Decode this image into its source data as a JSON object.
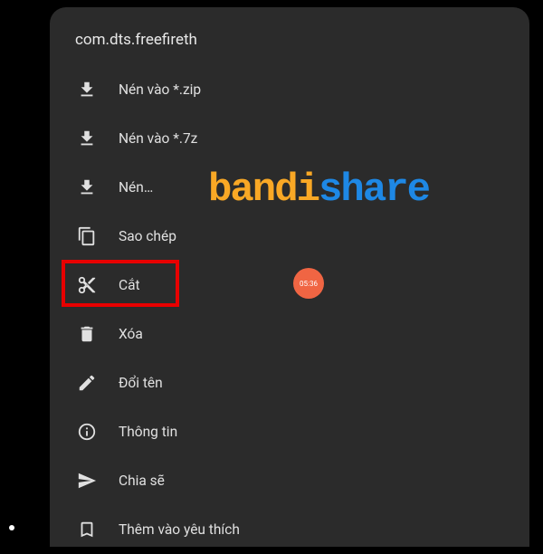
{
  "title": "com.dts.freefireth",
  "menu": [
    {
      "label": "Nén vào *.zip",
      "icon": "download-icon"
    },
    {
      "label": "Nén vào *.7z",
      "icon": "download-icon"
    },
    {
      "label": "Nén…",
      "icon": "download-icon"
    },
    {
      "label": "Sao chép",
      "icon": "copy-icon"
    },
    {
      "label": "Cắt",
      "icon": "cut-icon"
    },
    {
      "label": "Xóa",
      "icon": "delete-icon"
    },
    {
      "label": "Đổi tên",
      "icon": "edit-icon"
    },
    {
      "label": "Thông tin",
      "icon": "info-icon"
    },
    {
      "label": "Chia sẽ",
      "icon": "send-icon"
    },
    {
      "label": "Thêm vào yêu thích",
      "icon": "bookmark-icon"
    }
  ],
  "watermark": {
    "part1": "bandi",
    "part2": "share"
  },
  "badge": "05:36"
}
